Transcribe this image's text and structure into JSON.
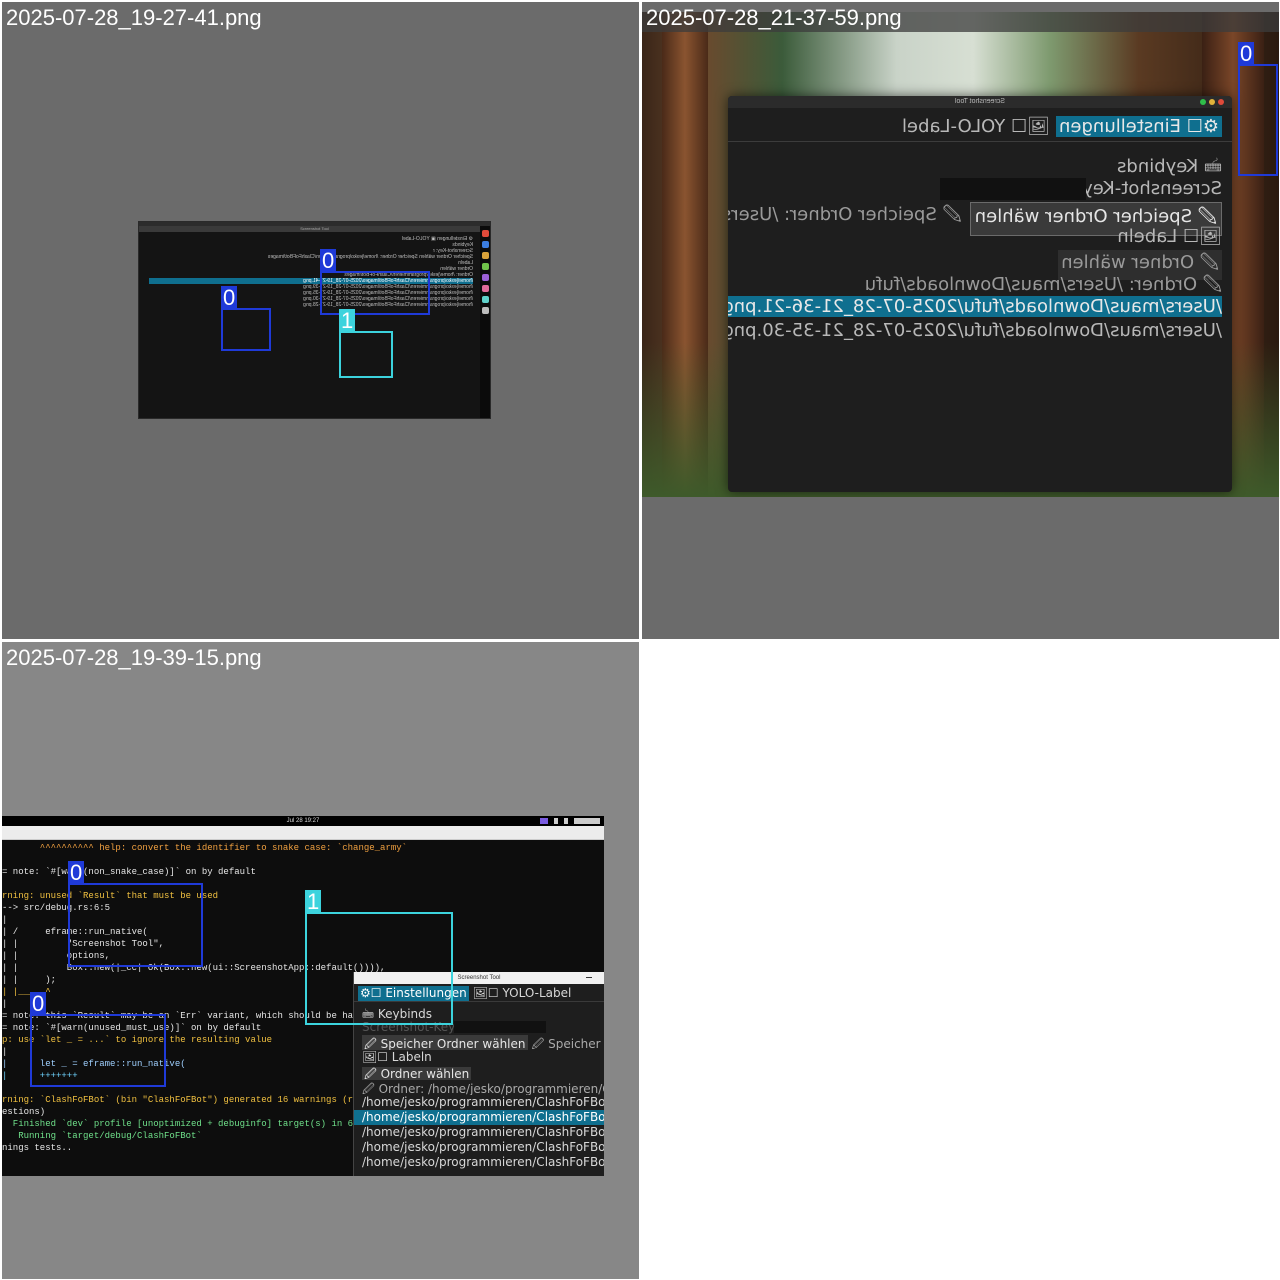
{
  "tiles": [
    {
      "caption": "2025-07-28_19-27-41.png",
      "background": "#6b6b6b",
      "screen": {
        "header_text": "Screenshot Tool",
        "ui_lines": [
          "⚙ Einstellungen  ▣ YOLO-Label",
          "Keybinds",
          "Screenshot-Key: r",
          "Speicher Ordner wählen  Speicher Ordner: /home/jesko/programmieren/ClashFoFBot/images",
          "Labeln",
          "Ordner wählen",
          "Ordner: /home/jesko/programmieren/ClashFoFBot/images",
          "/home/jesko/programmieren/ClashFoFBot/images/2025-07-28_19-27-41.png",
          "/home/jesko/programmieren/ClashFoFBot/images/2025-07-28_19-27-39.png",
          "/home/jesko/programmieren/ClashFoFBot/images/2025-07-28_19-27-35.png",
          "/home/jesko/programmieren/ClashFoFBot/images/2025-07-28_19-27-30.png",
          "/home/jesko/programmieren/ClashFoFBot/images/2025-07-28_19-27-28.png"
        ]
      },
      "boxes": [
        {
          "label": "0",
          "class_id": 0
        },
        {
          "label": "0",
          "class_id": 0
        },
        {
          "label": "1",
          "class_id": 1
        }
      ]
    },
    {
      "caption": "2025-07-28_21-37-59.png",
      "background": "#6b6b6b",
      "window": {
        "title": "Screenshot Tool",
        "tab_active": "⚙☐ Einstellungen",
        "tab_inactive": "🖼☐ YOLO-Label",
        "keybinds_header": "🖮 Keybinds",
        "screenshot_key_label": "Screenshot-Key: r",
        "choose_save_folder_button": "🖉 Speicher Ordner wählen",
        "save_folder_text": "🖉 Speicher Ordner: /Users/maus",
        "label_header": "🖼☐ Labeln",
        "choose_folder_button": "🖉 Ordner wählen",
        "folder_text": "🖉 Ordner: /Users/maus/Downloads/fufu",
        "files": [
          "/Users/maus/Downloads/fufu/2025-07-28_21-36-21.png",
          "/Users/maus/Downloads/fufu/2025-07-28_21-35-30.png"
        ]
      },
      "boxes": [
        {
          "label": "0",
          "class_id": 0
        }
      ]
    },
    {
      "caption": "2025-07-28_19-39-15.png",
      "background": "#878787",
      "topbar": {
        "clock": "Jul 28  19:27"
      },
      "terminal_lines": [
        "       ^^^^^^^^^^ help: convert the identifier to snake case: `change_army`",
        "",
        "= note: `#[warn(non_snake_case)]` on by default",
        "",
        "rning: unused `Result` that must be used",
        "--> src/debug.rs:6:5",
        "|",
        "| /     eframe::run_native(",
        "| |         \"Screenshot Tool\",",
        "| |         options,",
        "| |         Box::new(|_cc| Ok(Box::new(ui::ScreenshotApp::default()))),",
        "| |     );",
        "| |_____^",
        "|",
        "= note: this `Result` may be an `Err` variant, which should be han",
        "= note: `#[warn(unused_must_use)]` on by default",
        "p: use `let _ = ...` to ignore the resulting value",
        "|",
        "|      let _ = eframe::run_native(",
        "|      +++++++",
        "",
        "rning: `ClashFoFBot` (bin \"ClashFoFBot\") generated 16 warnings (run",
        "estions)",
        "  Finished `dev` profile [unoptimized + debuginfo] target(s) in 6.4",
        "   Running `target/debug/ClashFoFBot`",
        "nings tests.."
      ],
      "window": {
        "title": "Screenshot Tool",
        "tab_active": "⚙☐ Einstellungen",
        "tab_inactive": "🖼☐ YOLO-Label",
        "keybinds_header": "🖮 Keybinds",
        "screenshot_key_label": "Screenshot-Key: r",
        "choose_save_folder_button": "🖉 Speicher Ordner wählen",
        "save_folder_text": "🖉 Speicher Ordne",
        "label_header": "🖼☐ Labeln",
        "choose_folder_button": "🖉 Ordner wählen",
        "folder_text": "🖉 Ordner: /home/jesko/programmieren/Clash",
        "files": [
          "/home/jesko/programmieren/ClashFoFBot/im",
          "/home/jesko/programmieren/ClashFoFBot/im",
          "/home/jesko/programmieren/ClashFoFBot/im",
          "/home/jesko/programmieren/ClashFoFBot/im",
          "/home/jesko/programmieren/ClashFoFBot/im"
        ]
      },
      "boxes": [
        {
          "label": "0",
          "class_id": 0
        },
        {
          "label": "0",
          "class_id": 0
        },
        {
          "label": "1",
          "class_id": 1
        }
      ]
    }
  ],
  "colors": {
    "class_0": "#1f3ad8",
    "class_1": "#3cd3dd",
    "selected_row": "#0f6f8f",
    "window_bg": "#1e1e1e"
  }
}
